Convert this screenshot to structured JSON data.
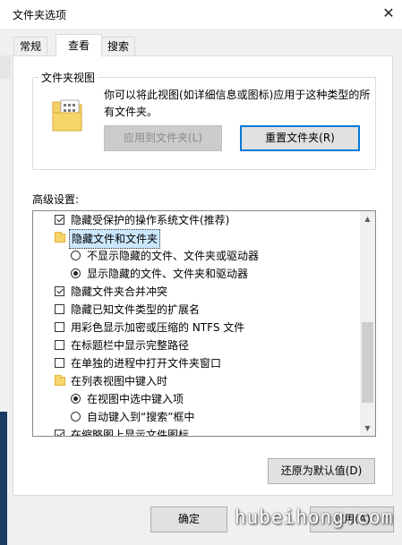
{
  "window": {
    "title": "文件夹选项",
    "close_glyph": "✕"
  },
  "tabs": [
    {
      "label": "常规"
    },
    {
      "label": "查看"
    },
    {
      "label": "搜索"
    }
  ],
  "folder_views": {
    "legend": "文件夹视图",
    "description": "你可以将此视图(如详细信息或图标)应用于这种类型的所有文件夹。",
    "apply_button": "应用到文件夹(L)",
    "reset_button": "重置文件夹(R)"
  },
  "advanced": {
    "label": "高级设置:",
    "items": [
      {
        "type": "checkbox",
        "checked": true,
        "label": "隐藏受保护的操作系统文件(推荐)"
      },
      {
        "type": "folder",
        "label": "隐藏文件和文件夹"
      },
      {
        "type": "radio",
        "checked": false,
        "label": "不显示隐藏的文件、文件夹或驱动器"
      },
      {
        "type": "radio",
        "checked": true,
        "label": "显示隐藏的文件、文件夹和驱动器"
      },
      {
        "type": "checkbox",
        "checked": true,
        "label": "隐藏文件夹合并冲突"
      },
      {
        "type": "checkbox",
        "checked": false,
        "label": "隐藏已知文件类型的扩展名"
      },
      {
        "type": "checkbox",
        "checked": false,
        "label": "用彩色显示加密或压缩的 NTFS 文件"
      },
      {
        "type": "checkbox",
        "checked": false,
        "label": "在标题栏中显示完整路径"
      },
      {
        "type": "checkbox",
        "checked": false,
        "label": "在单独的进程中打开文件夹窗口"
      },
      {
        "type": "folder",
        "label": "在列表视图中键入时"
      },
      {
        "type": "radio",
        "checked": true,
        "label": "在视图中选中键入项"
      },
      {
        "type": "radio",
        "checked": false,
        "label": "自动键入到“搜索”框中"
      },
      {
        "type": "checkbox",
        "checked": true,
        "label": "在缩略图上显示文件图标"
      }
    ]
  },
  "restore_button": "还原为默认值(D)",
  "footer": {
    "ok": "确定",
    "apply": "应用(A)"
  },
  "watermark": "hubeihong.com"
}
